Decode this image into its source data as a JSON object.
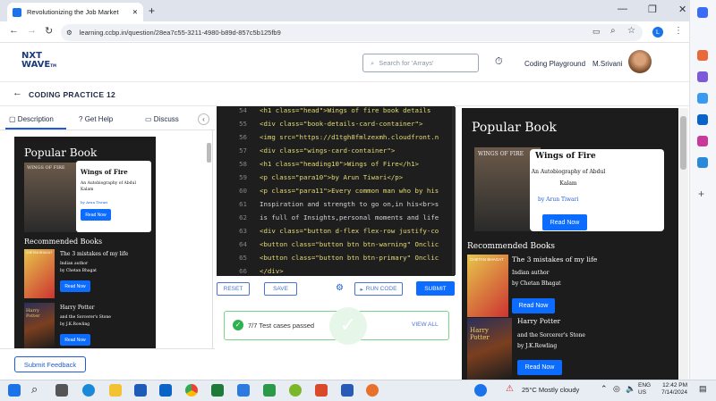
{
  "browser": {
    "tab_title": "Revolutionizing the Job Market",
    "url": "learning.ccbp.in/question/28ea7c55-3211-4980-b89d-857c5b125fb9",
    "profile_initial": "L"
  },
  "header": {
    "logo_line1": "NXT",
    "logo_line2": "WAVE",
    "logo_tm": "TM",
    "search_placeholder": "Search for 'Arrays'",
    "coding_playground": "Coding Playground",
    "user_name": "M.Srivani"
  },
  "page": {
    "title": "CODING PRACTICE 12"
  },
  "panel_tabs": {
    "description": "Description",
    "get_help": "Get Help",
    "discuss": "Discuss"
  },
  "preview": {
    "heading": "Popular Book",
    "book_title": "Wings of Fire",
    "subtitle": "An Autobiography of Abdul Kalam",
    "author": "by Arun Tiwari",
    "read_now": "Read Now",
    "image_caption": "WINGS OF FIRE",
    "recommended": "Recommended Books",
    "rec1_title": "The 3 mistakes of my life",
    "rec1_meta1": "Indian author",
    "rec1_meta2": "by Chetan Bhagat",
    "rec1_cover": "CHETAN BHAGAT",
    "rec2_title": "Harry Potter",
    "rec2_meta1": "and the Sorcerer's Stone",
    "rec2_meta2": "by J.K.Rowling",
    "rec2_cover": "Harry Potter"
  },
  "editor": {
    "lines": [
      {
        "no": "54",
        "code": "<h1 class=\"head\">Wings of fire book details"
      },
      {
        "no": "55",
        "code": "<div class=\"book-details-card-container\">"
      },
      {
        "no": "56",
        "code": "<img src=\"https://d1tgh8fmlzexmh.cloudfront.n"
      },
      {
        "no": "57",
        "code": "<div class=\"wings-card-container\">"
      },
      {
        "no": "58",
        "code": "<h1 class=\"heading10\">Wings of Fire</h1>"
      },
      {
        "no": "59",
        "code": "<p class=\"para10\">by Arun Tiwari</p>"
      },
      {
        "no": "60",
        "code": "<p class=\"para11\">Every common man who by his"
      },
      {
        "no": "61",
        "code": "Inspiration and strength to go on,in his<br>s"
      },
      {
        "no": "62",
        "code": "is full of Insights,personal moments and life"
      },
      {
        "no": "63",
        "code": "<div class=\"button d-flex flex-row justify-co"
      },
      {
        "no": "64",
        "code": "<button class=\"button btn btn-warning\" Onclic"
      },
      {
        "no": "65",
        "code": "<button class=\"button btn btn-primary\" Onclic"
      },
      {
        "no": "66",
        "code": "</div>"
      }
    ],
    "reset": "RESET",
    "save": "SAVE",
    "run_code": "RUN CODE",
    "submit": "SUBMIT"
  },
  "tests": {
    "status": "7/7 Test cases passed",
    "view_all": "VIEW ALL"
  },
  "feedback": {
    "label": "Submit Feedback"
  },
  "taskbar": {
    "weather": "25°C  Mostly cloudy",
    "lang1": "ENG",
    "lang2": "US",
    "time": "12:42 PM",
    "date": "7/14/2024"
  },
  "colors": {
    "accent": "#0b6cff",
    "brand": "#1a3a7a",
    "success": "#2fb150",
    "editor_bg": "#1e1e1e"
  }
}
